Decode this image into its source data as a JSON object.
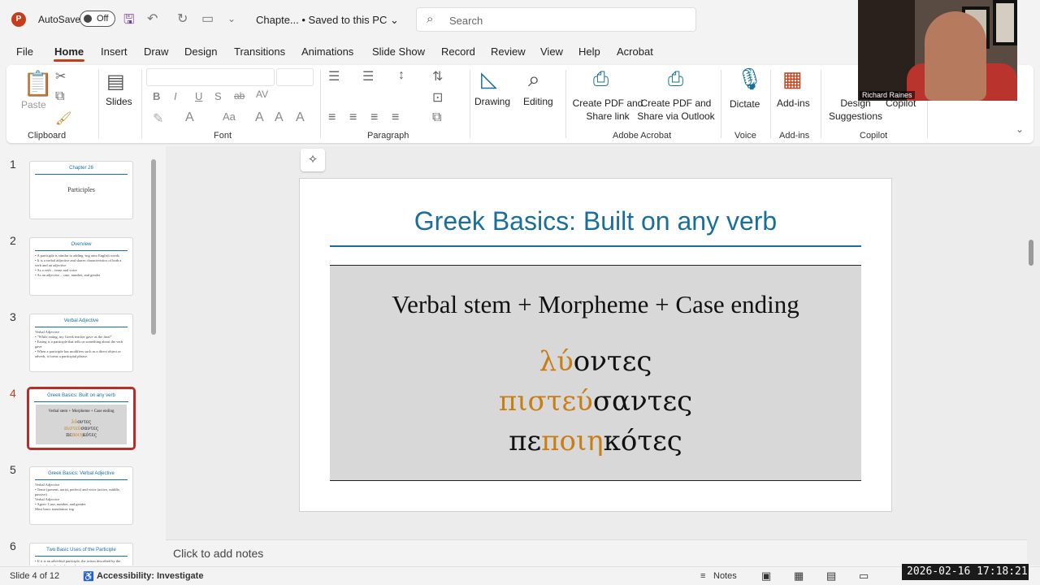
{
  "titlebar": {
    "autosave_label": "AutoSave",
    "autosave_state": "Off",
    "doc_title": "Chapte... • Saved to this PC ⌄",
    "search_placeholder": "Search"
  },
  "menu": [
    "File",
    "Home",
    "Insert",
    "Draw",
    "Design",
    "Transitions",
    "Animations",
    "Slide Show",
    "Record",
    "Review",
    "View",
    "Help",
    "Acrobat"
  ],
  "ribbon": {
    "clipboard": {
      "paste": "Paste",
      "label": "Clipboard"
    },
    "slides": {
      "label": "Slides"
    },
    "font": {
      "label": "Font"
    },
    "paragraph": {
      "label": "Paragraph"
    },
    "drawing": {
      "label": "Drawing"
    },
    "editing": {
      "label": "Editing"
    },
    "acrobat": {
      "create_pdf": "Create PDF and Share link",
      "create_pdf_outlook": "Create PDF and Share via Outlook",
      "label": "Adobe Acrobat"
    },
    "voice": {
      "dictate": "Dictate",
      "label": "Voice"
    },
    "addins": {
      "button": "Add-ins",
      "label": "Add-ins"
    },
    "copilot": {
      "design": "Design Suggestions",
      "copilot": "Copilot",
      "label": "Copilot"
    }
  },
  "thumbnails": [
    {
      "num": "1",
      "title": "Chapter 26",
      "body": "Participles"
    },
    {
      "num": "2",
      "title": "Overview",
      "body": "• A participle is similar to adding -ing onto English words\n• It is a verbal adjective and shares characteristics of both a verb and an adjective\n• As a verb – tense and voice\n• As an adjective – case, number, and gender"
    },
    {
      "num": "3",
      "title": "Verbal Adjective",
      "body": "Verbal Adjective\n• \"While eating, my Greek teacher gave us the final\"\n• Eating is a participle that tells us something about the verb gave\n• When a participle has modifiers such as a direct object or adverb, it forms a participial phrase."
    },
    {
      "num": "4",
      "title": "Greek Basics: Built on any verb",
      "body": "Verbal stem + Morpheme + Case ending"
    },
    {
      "num": "5",
      "title": "Greek Basics: Verbal Adjective",
      "body": "Verbal Adjective\n• Tense (present, aorist, perfect) and voice (active, middle, passive)\nVerbal Adjective\n• Agree: Case, number, and gender\nMost basic translation: ing"
    },
    {
      "num": "6",
      "title": "Two Basic Uses of the Participle",
      "body": "• If it is an adverbial participle, the action described by the participle is directed toward"
    }
  ],
  "slide": {
    "title": "Greek Basics: Built on any verb",
    "formula": "Verbal stem + Morpheme + Case ending",
    "words": [
      {
        "stem": "λύ",
        "rest": "οντες"
      },
      {
        "stem": "πιστεύ",
        "rest": "σαντες"
      },
      {
        "prefix": "πε",
        "stem": "ποιη",
        "rest": "κότες"
      }
    ]
  },
  "notes_placeholder": "Click to add notes",
  "status": {
    "slide_count": "Slide 4 of 12",
    "accessibility": "Accessibility: Investigate",
    "notes": "Notes"
  },
  "webcam": {
    "name": "Richard Raines"
  },
  "timestamp": "2026-02-16  17:18:21",
  "colors": {
    "accent": "#c43e1c",
    "title_blue": "#1a6f9a",
    "greek_orange": "#c77f15"
  }
}
